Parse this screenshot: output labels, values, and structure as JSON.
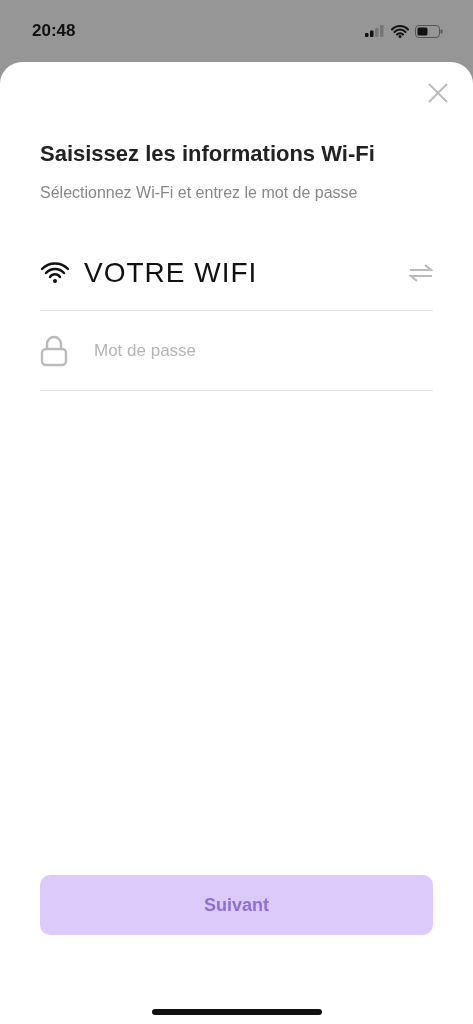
{
  "status_bar": {
    "time": "20:48"
  },
  "sheet": {
    "title": "Saisissez les informations Wi-Fi",
    "subtitle": "Sélectionnez Wi-Fi et entrez le mot de passe"
  },
  "wifi_field": {
    "value": "VOTRE WIFI"
  },
  "password_field": {
    "placeholder": "Mot de passe"
  },
  "next_button": {
    "label": "Suivant",
    "disabled": true
  }
}
